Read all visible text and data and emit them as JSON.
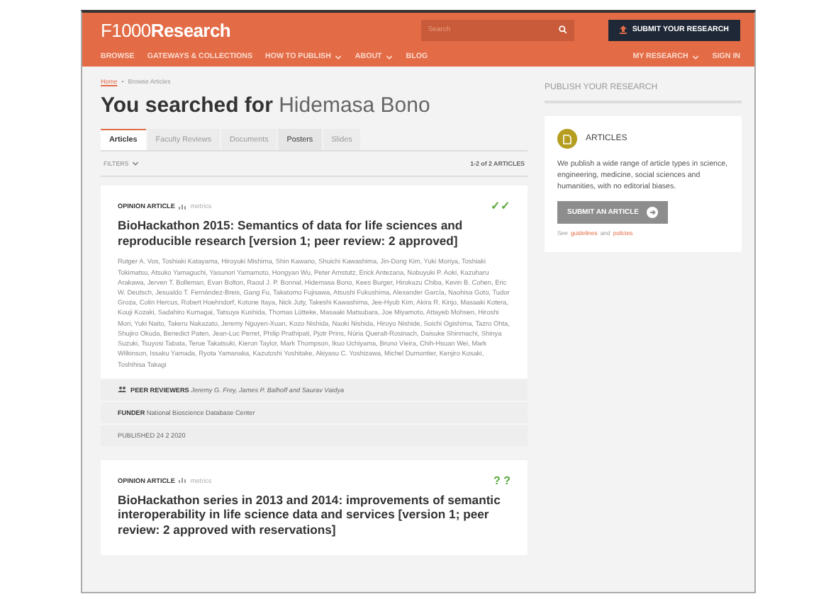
{
  "header": {
    "logo_light": "F1000",
    "logo_bold": "Research",
    "search": {
      "placeholder": "Search"
    },
    "submit_button": "SUBMIT YOUR RESEARCH",
    "nav": [
      {
        "label": "BROWSE",
        "dropdown": false
      },
      {
        "label": "GATEWAYS & COLLECTIONS",
        "dropdown": false
      },
      {
        "label": "HOW TO PUBLISH",
        "dropdown": true
      },
      {
        "label": "ABOUT",
        "dropdown": true
      },
      {
        "label": "BLOG",
        "dropdown": false
      }
    ],
    "nav_right": [
      {
        "label": "MY RESEARCH",
        "dropdown": true
      },
      {
        "label": "SIGN IN",
        "dropdown": false
      }
    ]
  },
  "breadcrumb": [
    "Home",
    "Browse Articles"
  ],
  "breadcrumb_separator": "•",
  "heading": {
    "prefix": "You searched for",
    "query": "Hidemasa Bono"
  },
  "tabs": [
    {
      "label": "Articles",
      "selected": true,
      "disabled": false
    },
    {
      "label": "Faculty Reviews",
      "selected": false,
      "disabled": true
    },
    {
      "label": "Documents",
      "selected": false,
      "disabled": true
    },
    {
      "label": "Posters",
      "selected": false,
      "disabled": false
    },
    {
      "label": "Slides",
      "selected": false,
      "disabled": true
    }
  ],
  "filters": "FILTERS",
  "result_count": "1-2 of 2 ARTICLES",
  "articles": [
    {
      "type": "OPINION ARTICLE",
      "metrics": "metrics",
      "status": "✓✓",
      "title": "BioHackathon 2015: Semantics of data for life sciences and reproducible research [version 1; peer review: 2 approved]",
      "authors": "Rutger A. Vos, Toshiaki Katayama, Hiroyuki Mishima, Shin Kawano, Shuichi Kawashima, Jin-Dong Kim, Yuki Moriya, Toshiaki Tokimatsu, Atsuko Yamaguchi, Yasunori Yamamoto, Hongyan Wu, Peter Amstutz, Erick Antezana, Nobuyuki P. Aoki, Kazuharu Arakawa, Jerven T. Bolleman, Evan Bolton, Raoul J. P. Bonnal, Hidemasa Bono, Kees Burger, Hirokazu Chiba, Kevin B. Cohen, Eric W. Deutsch, Jesualdo T. Fernández-Breis, Gang Fu, Takatomo Fujisawa, Atsushi Fukushima, Alexander García, Naohisa Goto, Tudor Groza, Colin Hercus, Robert Hoehndorf, Kotone Itaya, Nick Juty, Takeshi Kawashima, Jee-Hyub Kim, Akira R. Kinjo, Masaaki Kotera, Kouji Kozaki, Sadahiro Kumagai, Tatsuya Kushida, Thomas Lütteke, Masaaki Matsubara, Joe Miyamoto, Attayeb Mohsen, Hiroshi Mori, Yuki Naito, Takeru Nakazato, Jeremy Nguyen-Xuan, Kozo Nishida, Naoki Nishida, Hiroyo Nishide, Soichi Ogishima, Tazro Ohta, Shujiro Okuda, Benedict Paten, Jean-Luc Perret, Philip Prathipati, Pjotr Prins, Núria Queralt-Rosinach, Daisuke Shinmachi, Shinya Suzuki, Tsuyosi Tabata, Terue Takatsuki, Kieron Taylor, Mark Thompson, Ikuo Uchiyama, Bruno Vieira, Chih-Hsuan Wei, Mark Wilkinson, Issaku Yamada, Ryota Yamanaka, Kazutoshi Yoshitake, Akiyasu C. Yoshizawa, Michel Dumontier, Kenjiro Kosaki, Toshihisa Takagi",
      "reviewers": "**PEER REVIEWERS** *Jeremy G. Frey, James P. Balhoff and Saurav Vaidya*",
      "funder": "**FUNDER** National Bioscience Database Center",
      "published": "PUBLISHED 24 2 2020"
    },
    {
      "type": "OPINION ARTICLE",
      "metrics": "metrics",
      "status": "? ?",
      "title": "BioHackathon series in 2013 and 2014: improvements of semantic interoperability in life science data and services [version 1; peer review: 2 approved with reservations]"
    }
  ],
  "sidebar": {
    "heading": "PUBLISH YOUR RESEARCH",
    "card_title": "ARTICLES",
    "text": "We publish a wide range of article types in science, engineering, medicine, social sciences and humanities, with no editorial biases.",
    "button": "SUBMIT AN ARTICLE",
    "links": [
      "See",
      "guidelines",
      "and",
      "policies"
    ]
  }
}
